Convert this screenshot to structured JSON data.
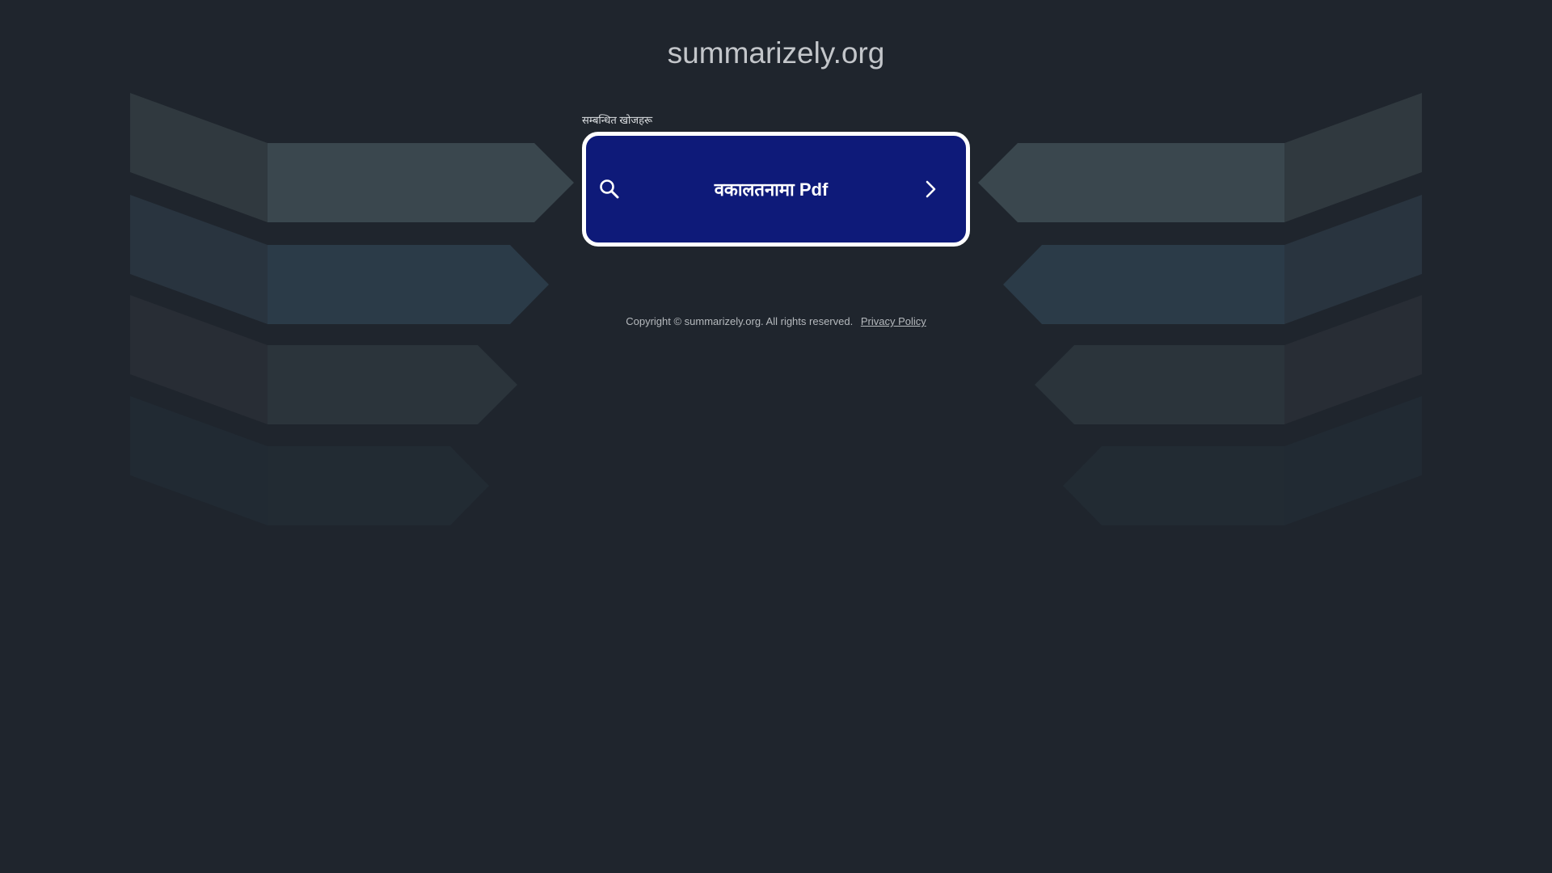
{
  "site": {
    "title": "summarizely.org"
  },
  "related": {
    "label": "सम्बन्धित खोजहरू"
  },
  "search_result": {
    "text": "वकालतनामा Pdf",
    "icon_left": "search-icon",
    "icon_right": "chevron-right-icon"
  },
  "footer": {
    "copyright": "Copyright © summarizely.org.  All rights reserved.",
    "privacy_label": "Privacy Policy"
  },
  "colors": {
    "background": "#1f252d",
    "card": "#0e1a79",
    "card_border": "#ffffff"
  }
}
